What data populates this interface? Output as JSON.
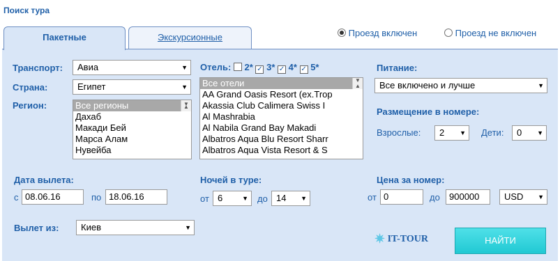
{
  "title": "Поиск тура",
  "tabs": {
    "packages": "Пакетные",
    "excursions": "Экскурсионные"
  },
  "travel_options": {
    "included": "Проезд включен",
    "not_included": "Проезд не включен"
  },
  "transport": {
    "label": "Транспорт:",
    "value": "Авиа"
  },
  "country": {
    "label": "Страна:",
    "value": "Египет"
  },
  "region": {
    "label": "Регион:",
    "items": [
      "Все регионы",
      "Дахаб",
      "Макади Бей",
      "Марса Алам",
      "Нувейба"
    ]
  },
  "hotel": {
    "label": "Отель:",
    "stars": [
      "2*",
      "3*",
      "4*",
      "5*"
    ],
    "items": [
      "Все отели",
      "AA Grand Oasis Resort (ex.Trop",
      "Akassia Club Calimera Swiss I",
      "Al Mashrabia",
      "Al Nabila Grand Bay Makadi",
      "Albatros Aqua Blu Resort Sharr",
      "Albatros Aqua Vista Resort & S"
    ]
  },
  "meal": {
    "label": "Питание:",
    "value": "Все включено и лучше"
  },
  "accommodation": {
    "label": "Размещение в номере:",
    "adults_label": "Взрослые:",
    "adults": "2",
    "children_label": "Дети:",
    "children": "0"
  },
  "departure_date": {
    "label": "Дата вылета:",
    "from_label": "с",
    "from": "08.06.16",
    "to_label": "по",
    "to": "18.06.16"
  },
  "nights": {
    "label": "Ночей в туре:",
    "from_label": "от",
    "from": "6",
    "to_label": "до",
    "to": "14"
  },
  "price": {
    "label": "Цена за номер:",
    "from_label": "от",
    "from": "0",
    "to_label": "до",
    "to": "900000",
    "currency": "USD"
  },
  "departure_city": {
    "label": "Вылет из:",
    "value": "Киев"
  },
  "logo": "IT-TOUR",
  "search_button": "НАЙТИ"
}
